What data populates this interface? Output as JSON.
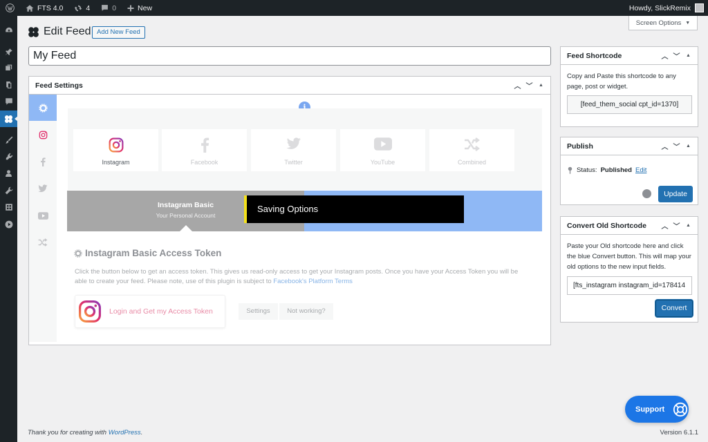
{
  "admin_bar": {
    "site_name": "FTS 4.0",
    "updates_count": "4",
    "comments_count": "0",
    "new_label": "New",
    "greeting": "Howdy, SlickRemix"
  },
  "screen_options": {
    "label": "Screen Options"
  },
  "header": {
    "title": "Edit Feed",
    "add_new_label": "Add New Feed"
  },
  "post_title": {
    "value": "My Feed"
  },
  "feed_settings": {
    "title": "Feed Settings",
    "social_options": [
      {
        "label": "Instagram",
        "icon": "instagram-icon"
      },
      {
        "label": "Facebook",
        "icon": "facebook-icon"
      },
      {
        "label": "Twitter",
        "icon": "twitter-icon"
      },
      {
        "label": "YouTube",
        "icon": "youtube-icon"
      },
      {
        "label": "Combined",
        "icon": "combined-icon"
      }
    ],
    "account": {
      "title": "Instagram Basic",
      "subtitle": "Your Personal Account"
    },
    "toast": "Saving Options",
    "token": {
      "title": "Instagram Basic Access Token",
      "description": "Click the button below to get an access token. This gives us read-only access to get your Instagram posts. Once you have your Access Token you will be able to create your feed. Please note, use of this plugin is subject to ",
      "link_text": "Facebook's Platform Terms",
      "login_label": "Login and Get my Access Token",
      "settings_label": "Settings",
      "not_working_label": "Not working?"
    }
  },
  "feed_shortcode": {
    "title": "Feed Shortcode",
    "description": "Copy and Paste this shortcode to any page, post or widget.",
    "shortcode": "[feed_them_social cpt_id=1370]"
  },
  "publish": {
    "title": "Publish",
    "status_label": "Status:",
    "status_value": "Published",
    "edit_label": "Edit",
    "update_label": "Update"
  },
  "convert": {
    "title": "Convert Old Shortcode",
    "description": "Paste your Old shortcode here and click the blue Convert button. This will map your old options to the new input fields.",
    "shortcode": "[fts_instagram instagram_id=178414",
    "button_label": "Convert"
  },
  "support": {
    "label": "Support"
  },
  "footer": {
    "thanks_prefix": "Thank you for creating with ",
    "wordpress_link": "WordPress",
    "thanks_suffix": ".",
    "version": "Version 6.1.1"
  },
  "colors": {
    "accent": "#2271b1",
    "tab_active": "#8fb8f5",
    "toast_bar": "#f5e21b",
    "support": "#1c76e6"
  }
}
